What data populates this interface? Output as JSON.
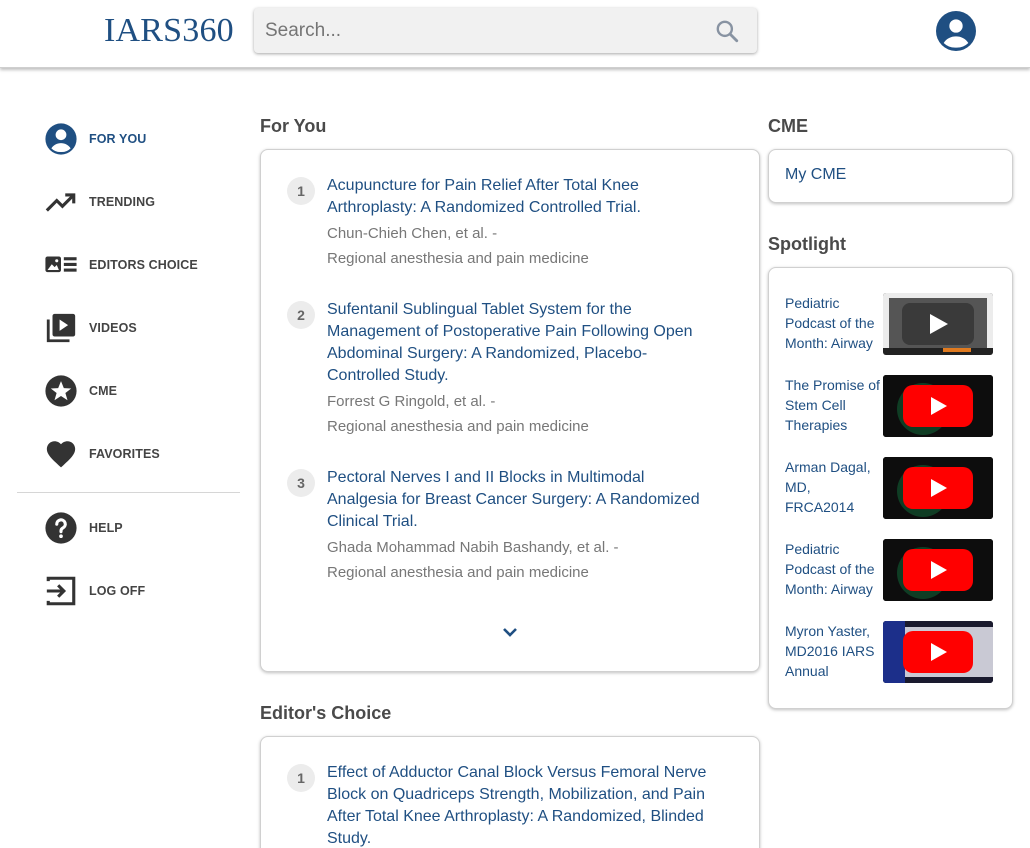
{
  "header": {
    "logo": "IARS360",
    "search_placeholder": "Search..."
  },
  "sidebar": {
    "items": [
      {
        "label": "FOR YOU",
        "icon": "account-circle-icon",
        "active": true
      },
      {
        "label": "TRENDING",
        "icon": "trending-up-icon"
      },
      {
        "label": "EDITORS CHOICE",
        "icon": "article-image-icon"
      },
      {
        "label": "VIDEOS",
        "icon": "video-library-icon"
      },
      {
        "label": "CME",
        "icon": "star-circle-icon"
      },
      {
        "label": "FAVORITES",
        "icon": "heart-icon"
      },
      {
        "label": "HELP",
        "icon": "help-circle-icon"
      },
      {
        "label": "LOG OFF",
        "icon": "logout-icon"
      }
    ]
  },
  "for_you": {
    "title": "For You",
    "articles": [
      {
        "num": "1",
        "title": "Acupuncture for Pain Relief After Total Knee Arthroplasty: A Randomized Controlled Trial.",
        "authors": "Chun-Chieh Chen, et al. -",
        "journal": "Regional anesthesia and pain medicine"
      },
      {
        "num": "2",
        "title": "Sufentanil Sublingual Tablet System for the Management of Postoperative Pain Following Open Abdominal Surgery: A Randomized, Placebo-Controlled Study.",
        "authors": "Forrest G Ringold, et al. -",
        "journal": "Regional anesthesia and pain medicine"
      },
      {
        "num": "3",
        "title": "Pectoral Nerves I and II Blocks in Multimodal Analgesia for Breast Cancer Surgery: A Randomized Clinical Trial.",
        "authors": "Ghada Mohammad Nabih Bashandy, et al. -",
        "journal": "Regional anesthesia and pain medicine"
      }
    ]
  },
  "editors_choice": {
    "title": "Editor's Choice",
    "articles": [
      {
        "num": "1",
        "title": "Effect of Adductor Canal Block Versus Femoral Nerve Block on Quadriceps Strength, Mobilization, and Pain After Total Knee Arthroplasty: A Randomized, Blinded Study."
      }
    ]
  },
  "cme": {
    "title": "CME",
    "link": "My CME"
  },
  "spotlight": {
    "title": "Spotlight",
    "items": [
      {
        "title": "Pediatric Podcast of the Month: Airway",
        "play": "gray"
      },
      {
        "title": "The Promise of Stem Cell Therapies",
        "play": "red"
      },
      {
        "title": "Arman Dagal, MD, FRCA2014",
        "play": "red"
      },
      {
        "title": "Pediatric Podcast of the Month: Airway",
        "play": "red"
      },
      {
        "title": "Myron Yaster, MD2016 IARS Annual",
        "play": "red"
      }
    ]
  },
  "colors": {
    "brand": "#1f4f82",
    "play_red": "#ff0000"
  }
}
